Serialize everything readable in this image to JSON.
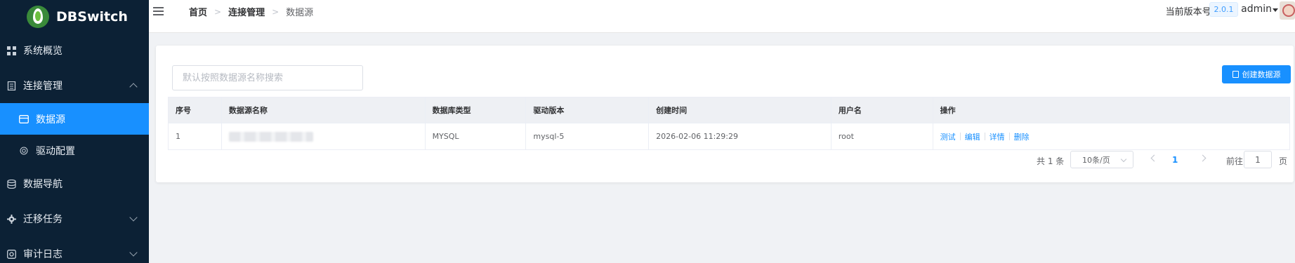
{
  "app": {
    "name": "DBSwitch"
  },
  "sidebar": {
    "items": [
      {
        "label": "系统概览",
        "icon": "grid-icon"
      },
      {
        "label": "连接管理",
        "icon": "document-icon",
        "expanded": true,
        "children": [
          {
            "label": "数据源",
            "icon": "card-icon",
            "active": true
          },
          {
            "label": "驱动配置",
            "icon": "gear-circle-icon"
          }
        ]
      },
      {
        "label": "数据导航",
        "icon": "database-icon"
      },
      {
        "label": "迁移任务",
        "icon": "gear-icon",
        "expanded": false
      },
      {
        "label": "审计日志",
        "icon": "log-icon",
        "expanded": false
      }
    ]
  },
  "header": {
    "breadcrumb": [
      "首页",
      "连接管理",
      "数据源"
    ],
    "version_label": "当前版本号:",
    "version": "2.0.1",
    "user": "admin"
  },
  "main": {
    "search_placeholder": "默认按照数据源名称搜索",
    "create_button": "创建数据源",
    "table": {
      "columns": [
        "序号",
        "数据源名称",
        "数据库类型",
        "驱动版本",
        "创建时间",
        "用户名",
        "操作"
      ],
      "rows": [
        {
          "index": "1",
          "name": "",
          "db_type": "MYSQL",
          "driver": "mysql-5",
          "created": "2026-02-06 11:29:29",
          "user": "root",
          "actions": [
            "测试",
            "编辑",
            "详情",
            "删除"
          ]
        }
      ]
    },
    "pagination": {
      "total": "共 1 条",
      "page_size": "10条/页",
      "current_page": "1",
      "goto_label": "前往",
      "goto_value": "1",
      "goto_suffix": "页"
    }
  },
  "colors": {
    "sidebar_bg": "#0c2135",
    "accent": "#1890ff"
  }
}
